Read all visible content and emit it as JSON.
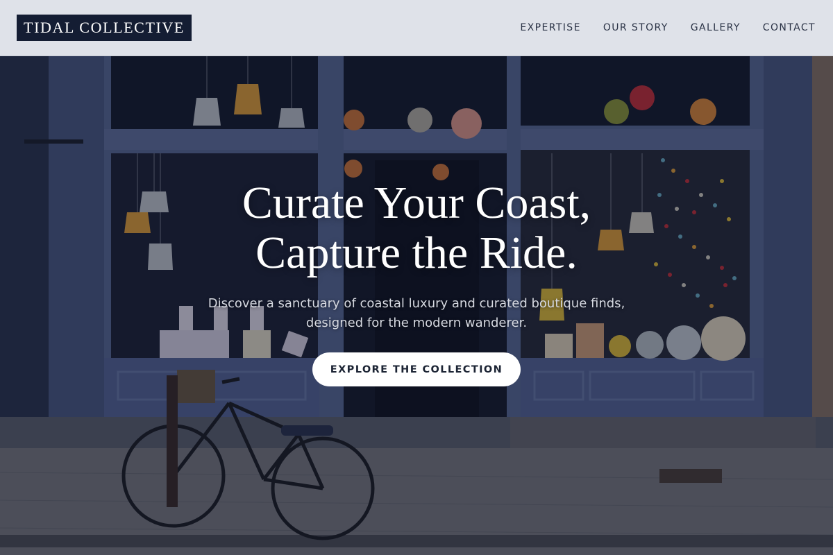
{
  "brand": {
    "logo_text": "TIDAL COLLECTIVE"
  },
  "nav": {
    "items": [
      {
        "label": "EXPERTISE"
      },
      {
        "label": "OUR STORY"
      },
      {
        "label": "GALLERY"
      },
      {
        "label": "CONTACT"
      }
    ]
  },
  "hero": {
    "headline_line1": "Curate Your Coast,",
    "headline_line2": "Capture the Ride.",
    "subtitle_line1": "Discover a sanctuary of coastal luxury and curated boutique finds,",
    "subtitle_line2": "designed for the modern wanderer.",
    "cta_label": "EXPLORE THE COLLECTION",
    "background_image_text": "suite.surf"
  },
  "colors": {
    "header_bg": "#dfe2e9",
    "logo_bg": "#141d33",
    "nav_text": "#2a3245",
    "cta_bg": "#ffffff",
    "cta_text": "#1c2434",
    "storefront_blue": "#4a5a85"
  }
}
